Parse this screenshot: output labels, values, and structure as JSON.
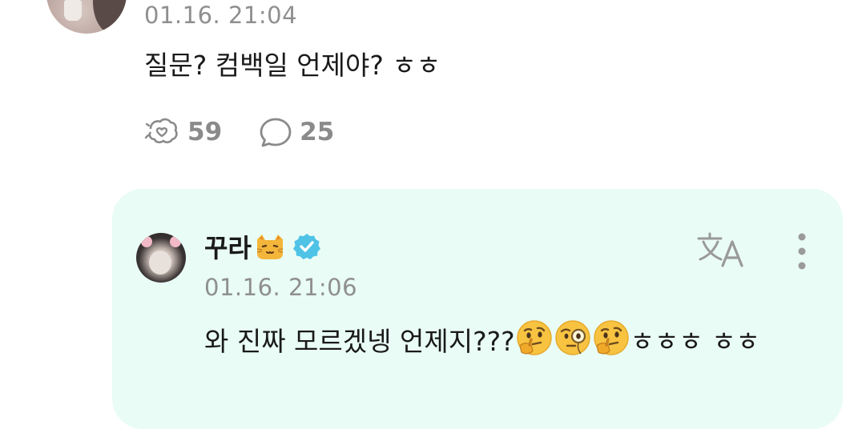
{
  "comment": {
    "timestamp": "01.16. 21:04",
    "text": "질문? 컴백일 언제야? ㅎㅎ",
    "likes_count": "59",
    "replies_count": "25",
    "like_icon": "bubble-heart-icon",
    "reply_icon": "speech-bubble-icon"
  },
  "reply": {
    "author_name": "꾸라",
    "author_emoji": "cat-face-emoji",
    "verified_icon": "verified-badge-icon",
    "verified_color": "#4fc3e6",
    "timestamp": "01.16. 21:06",
    "text_prefix": "와 진짜 모르겠넹 언제지???",
    "emojis": [
      "thinking-face-emoji",
      "face-with-monocle-emoji",
      "thinking-face-emoji"
    ],
    "text_suffix": "ㅎㅎㅎ ㅎㅎ",
    "translate_icon": "translate-icon",
    "more_icon": "more-vertical-icon"
  },
  "colors": {
    "reply_background": "#e9fcf6",
    "muted_text": "#8f8f8f",
    "primary_text": "#1a1a1a"
  }
}
